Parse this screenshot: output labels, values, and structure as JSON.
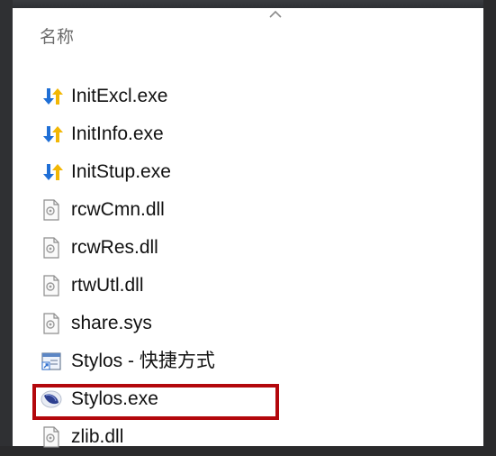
{
  "header": {
    "column_name": "名称"
  },
  "files": [
    {
      "name": "InitExcl.exe",
      "icon": "installer-arrows-icon"
    },
    {
      "name": "InitInfo.exe",
      "icon": "installer-arrows-icon"
    },
    {
      "name": "InitStup.exe",
      "icon": "installer-arrows-icon"
    },
    {
      "name": "rcwCmn.dll",
      "icon": "dll-file-icon"
    },
    {
      "name": "rcwRes.dll",
      "icon": "dll-file-icon"
    },
    {
      "name": "rtwUtl.dll",
      "icon": "dll-file-icon"
    },
    {
      "name": "share.sys",
      "icon": "system-file-icon"
    },
    {
      "name": "Stylos - 快捷方式",
      "icon": "shortcut-icon"
    },
    {
      "name": "Stylos.exe",
      "icon": "stylos-app-icon",
      "highlighted": true
    },
    {
      "name": "zlib.dll",
      "icon": "dll-file-icon"
    }
  ],
  "colors": {
    "highlight": "#b3070c",
    "arrow_blue": "#1f6fd6",
    "arrow_yellow": "#f2b705"
  }
}
